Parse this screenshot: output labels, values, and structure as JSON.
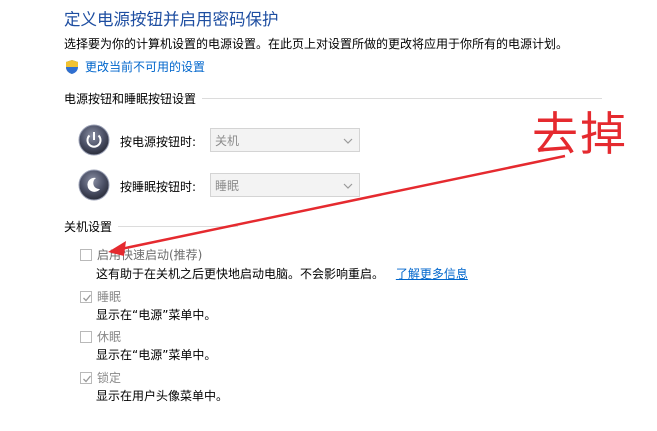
{
  "header": {
    "title": "定义电源按钮并启用密码保护",
    "description": "选择要为你的计算机设置的电源设置。在此页上对设置所做的更改将应用于你所有的电源计划。",
    "change_link": "更改当前不可用的设置"
  },
  "power_buttons": {
    "section_title": "电源按钮和睡眠按钮设置",
    "rows": [
      {
        "label": "按电源按钮时:",
        "value": "关机",
        "icon": "power-icon"
      },
      {
        "label": "按睡眠按钮时:",
        "value": "睡眠",
        "icon": "sleep-icon"
      }
    ]
  },
  "shutdown": {
    "section_title": "关机设置",
    "items": [
      {
        "label": "启用快速启动(推荐)",
        "checked": false,
        "desc": "这有助于在关机之后更快地启动电脑。不会影响重启。",
        "link": "了解更多信息"
      },
      {
        "label": "睡眠",
        "checked": true,
        "desc": "显示在“电源”菜单中。"
      },
      {
        "label": "休眠",
        "checked": false,
        "desc": "显示在“电源”菜单中。"
      },
      {
        "label": "锁定",
        "checked": true,
        "desc": "显示在用户头像菜单中。"
      }
    ]
  },
  "annotation": {
    "text": "去掉",
    "color": "#e52a2f"
  }
}
